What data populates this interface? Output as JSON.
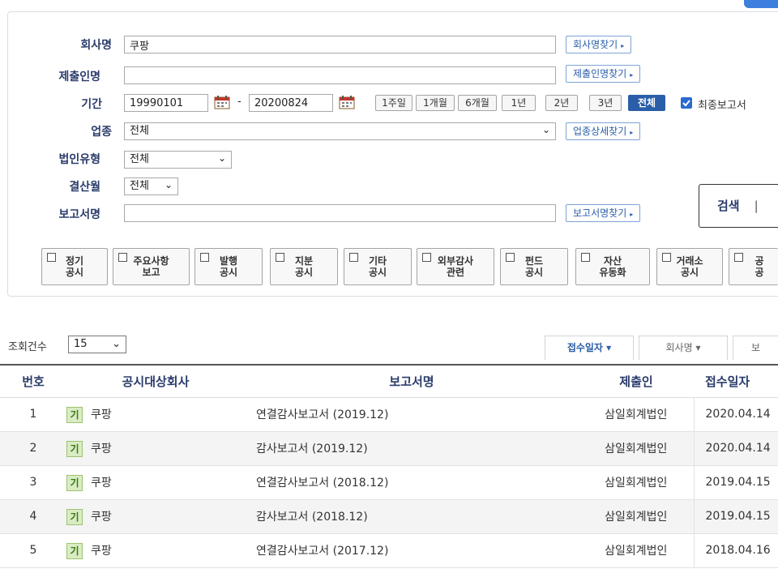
{
  "form": {
    "company_label": "회사명",
    "company_value": "쿠팡",
    "company_find": "회사명찾기",
    "submitter_label": "제출인명",
    "submitter_value": "",
    "submitter_find": "제출인명찾기",
    "period_label": "기간",
    "date_from": "19990101",
    "date_sep": "-",
    "date_to": "20200824",
    "period_buttons": [
      "1주일",
      "1개월",
      "6개월",
      "1년",
      "2년",
      "3년",
      "전체"
    ],
    "period_selected": "전체",
    "final_report_label": "최종보고서",
    "final_report_checked": true,
    "industry_label": "업종",
    "industry_value": "전체",
    "industry_find": "업종상세찾기",
    "corp_type_label": "법인유형",
    "corp_type_value": "전체",
    "settle_label": "결산월",
    "settle_value": "전체",
    "report_label": "보고서명",
    "report_value": "",
    "report_find": "보고서명찾기",
    "search_label": "검색"
  },
  "categories": [
    [
      "정기",
      "공시"
    ],
    [
      "주요사항",
      "보고"
    ],
    [
      "발행",
      "공시"
    ],
    [
      "지분",
      "공시"
    ],
    [
      "기타",
      "공시"
    ],
    [
      "외부감사",
      "관련"
    ],
    [
      "펀드",
      "공시"
    ],
    [
      "자산",
      "유동화"
    ],
    [
      "거래소",
      "공시"
    ],
    [
      "공",
      "공"
    ]
  ],
  "results": {
    "count_label": "조회건수",
    "count_value": "15",
    "sort_buttons": [
      "접수일자 ▾",
      "회사명 ▾",
      "보"
    ],
    "columns": [
      "번호",
      "공시대상회사",
      "보고서명",
      "제출인",
      "접수일자"
    ],
    "rows": [
      {
        "no": "1",
        "badge": "기",
        "company": "쿠팡",
        "report": "연결감사보고서 (2019.12)",
        "submitter": "삼일회계법인",
        "date": "2020.04.14"
      },
      {
        "no": "2",
        "badge": "기",
        "company": "쿠팡",
        "report": "감사보고서 (2019.12)",
        "submitter": "삼일회계법인",
        "date": "2020.04.14"
      },
      {
        "no": "3",
        "badge": "기",
        "company": "쿠팡",
        "report": "연결감사보고서 (2018.12)",
        "submitter": "삼일회계법인",
        "date": "2019.04.15"
      },
      {
        "no": "4",
        "badge": "기",
        "company": "쿠팡",
        "report": "감사보고서 (2018.12)",
        "submitter": "삼일회계법인",
        "date": "2019.04.15"
      },
      {
        "no": "5",
        "badge": "기",
        "company": "쿠팡",
        "report": "연결감사보고서 (2017.12)",
        "submitter": "삼일회계법인",
        "date": "2018.04.16"
      }
    ]
  },
  "colors": {
    "accent": "#2a5ea8",
    "label": "#2b3c6b",
    "badge_bg": "#d9ecc4"
  }
}
